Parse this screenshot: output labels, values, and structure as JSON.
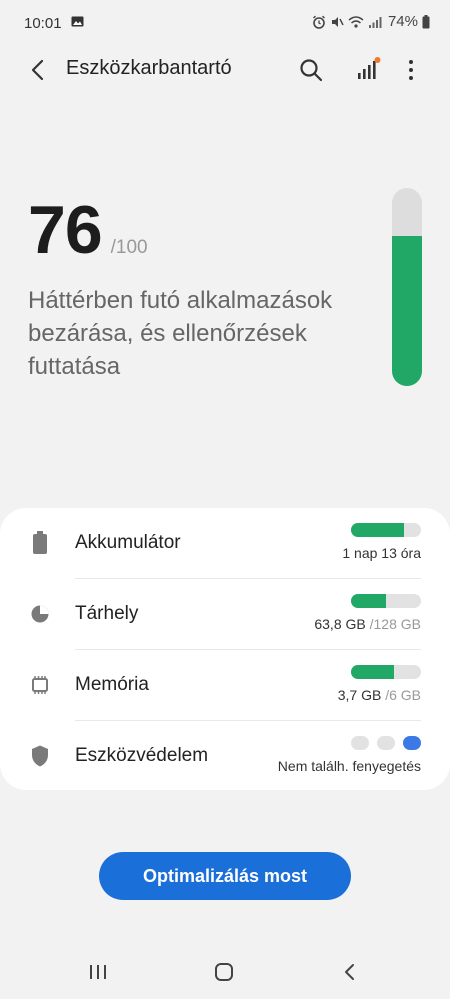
{
  "status_bar": {
    "time": "10:01",
    "battery_percent": "74%",
    "icons": [
      "image-icon",
      "alarm-icon",
      "mute-icon",
      "wifi-icon",
      "signal-icon",
      "battery-icon"
    ]
  },
  "app_bar": {
    "title": "Eszközkarbantartó",
    "icons": [
      "back-icon",
      "search-icon",
      "stats-icon",
      "more-icon"
    ]
  },
  "score": {
    "value": "76",
    "max": "/100",
    "description": "Háttérben futó alkalmazások bezárása, és ellenőrzések futtatása",
    "fill_fraction": 0.76
  },
  "items": [
    {
      "label": "Akkumulátor",
      "icon": "battery-icon",
      "sub": "1 nap 13 óra",
      "sub_muted": "",
      "fill_fraction": 0.75
    },
    {
      "label": "Tárhely",
      "icon": "pie-chart-icon",
      "sub": "63,8 GB",
      "sub_muted": " /128 GB",
      "fill_fraction": 0.5
    },
    {
      "label": "Memória",
      "icon": "memory-chip-icon",
      "sub": "3,7 GB",
      "sub_muted": " /6 GB",
      "fill_fraction": 0.62
    },
    {
      "label": "Eszközvédelem",
      "icon": "shield-icon",
      "sub": "Nem találh. fenyegetés",
      "sub_muted": "",
      "dots": [
        false,
        false,
        true
      ]
    }
  ],
  "optimize_button": {
    "label": "Optimalizálás most"
  },
  "nav_bar": {
    "icons": [
      "recent-apps-icon",
      "home-icon",
      "back-icon"
    ]
  },
  "colors": {
    "accent_green": "#22a866",
    "button_blue": "#1a6fd8",
    "dot_blue": "#3b7ae6",
    "background": "#f2f2f2"
  }
}
